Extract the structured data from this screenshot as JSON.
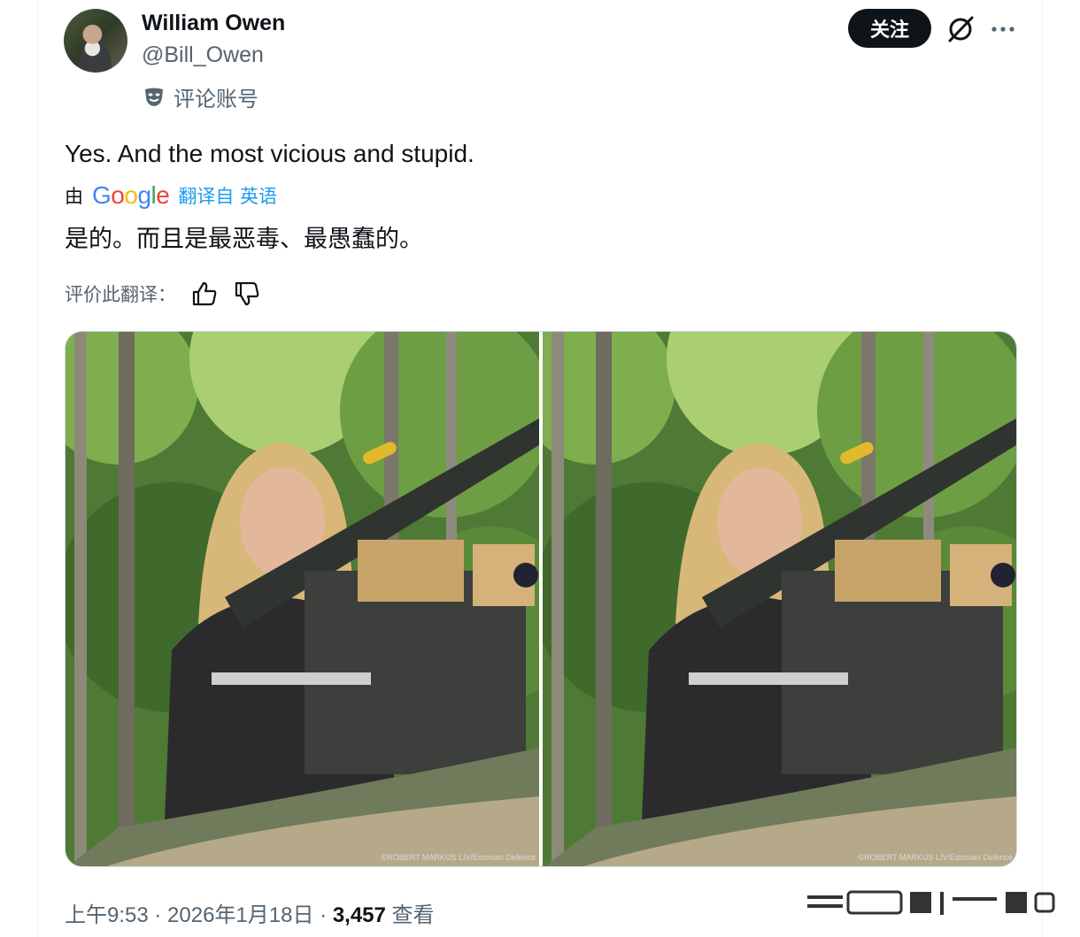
{
  "tweet": {
    "author_name": "William Owen",
    "author_handle": "@Bill_Owen",
    "badge_label": "评论账号",
    "follow_label": "关注",
    "text": "Yes. And the most vicious and stupid.",
    "translation": {
      "by_label": "由",
      "provider": "Google",
      "link_label": "翻译自 英语",
      "text": "是的。而且是最恶毒、最愚蠢的。"
    },
    "rate_label": "评价此翻译：",
    "media": [
      {
        "credit": "©ROBERT MARKUS LIV/Estonian Defence"
      },
      {
        "credit": "©ROBERT MARKUS LIV/Estonian Defence"
      }
    ],
    "meta": {
      "time": "上午9:53",
      "date": "2026年1月18日",
      "separator": " · ",
      "views_count": "3,457",
      "views_label": "查看"
    }
  },
  "icons": {
    "badge": "comedy-mask-icon",
    "grok": "grok-icon",
    "more": "more-icon",
    "thumbs_up": "thumbs-up-icon",
    "thumbs_down": "thumbs-down-icon"
  },
  "colors": {
    "accent": "#1d9bf0",
    "text": "#0f1419",
    "secondary": "#536471",
    "button_bg": "#0f1419"
  }
}
